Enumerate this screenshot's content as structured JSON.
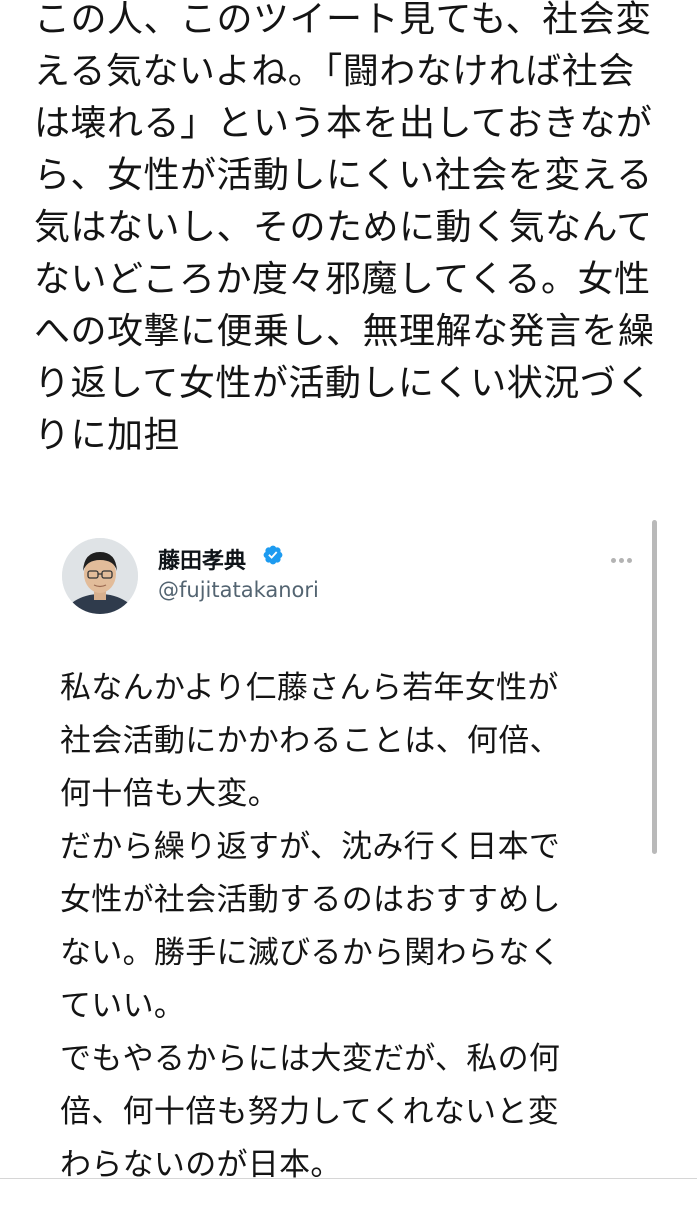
{
  "post": {
    "lines": [
      "この人、このツイート見ても、社会変",
      "える気ないよね。「闘わなければ社会",
      "は壊れる」という本を出しておきなが",
      "ら、女性が活動しにくい社会を変える",
      "気はないし、そのために動く気なんて",
      "ないどころか度々邪魔してくる。女性",
      "への攻撃に便乗し、無理解な発言を繰",
      "り返して女性が活動しにくい状況づく",
      "りに加担"
    ]
  },
  "quoted_tweet": {
    "author_name": "藤田孝典",
    "handle": "@fujitatakanori",
    "verified": true,
    "body_lines": [
      "私なんかより仁藤さんら若年女性が",
      "社会活動にかかわることは、何倍、",
      "何十倍も大変。",
      "だから繰り返すが、沈み行く日本で",
      "女性が社会活動するのはおすすめし",
      "ない。勝手に滅びるから関わらなく",
      "ていい。",
      "でもやるからには大変だが、私の何",
      "倍、何十倍も努力してくれないと変",
      "わらないのが日本。"
    ]
  },
  "colors": {
    "verified_badge": "#1d9bf0",
    "handle_text": "#536471"
  },
  "icons": {
    "verified": "verified-badge-icon",
    "more": "more-options-icon"
  }
}
